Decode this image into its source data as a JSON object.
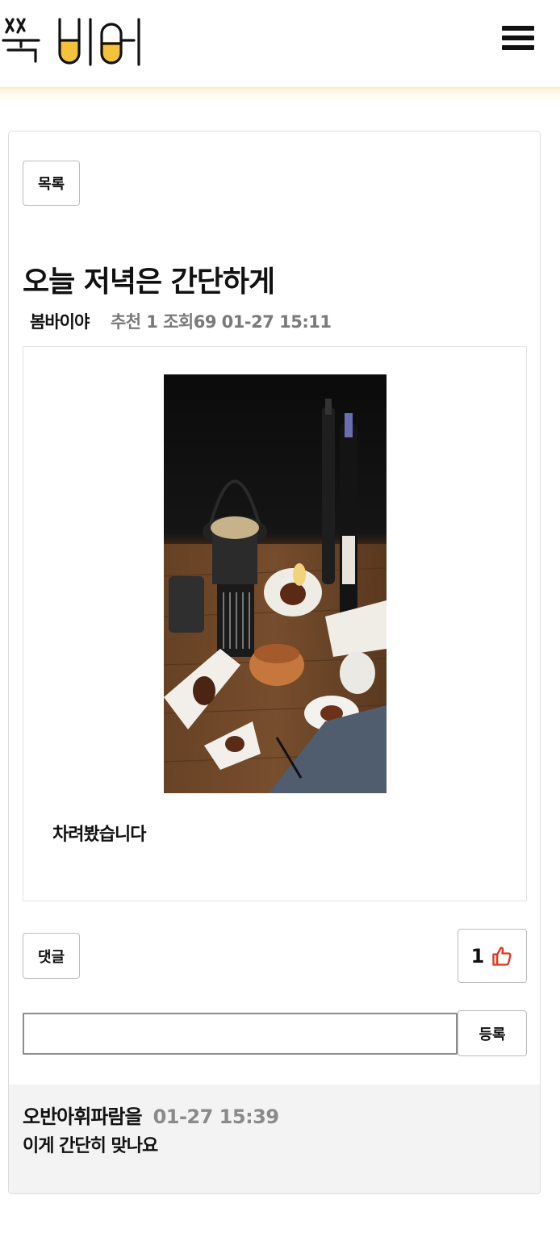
{
  "header": {
    "logo_text": "쏙비어",
    "menu_icon": "hamburger-icon"
  },
  "toolbar": {
    "list_label": "목록"
  },
  "post": {
    "title": "오늘 저녁은 간단하게",
    "author": "봄바이야",
    "recommend_label": "추천",
    "recommend_count": "1",
    "views_label": "조회",
    "views_count": "69",
    "datetime": "01-27 15:11",
    "body_text": "차려봤습니다",
    "photo_icon": "food-photo"
  },
  "comments_section": {
    "comment_label": "댓글",
    "like_count": "1",
    "like_icon": "thumbs-up-icon",
    "input_value": "",
    "submit_label": "등록",
    "items": [
      {
        "author": "오반아휘파람을",
        "time": "01-27 15:39",
        "text": "이게 간단히 맞나요"
      }
    ]
  },
  "colors": {
    "accent": "#f5c33b",
    "like_red": "#e8301c",
    "muted_text": "#7a7a7a",
    "comment_bg": "#f3f3f3"
  }
}
